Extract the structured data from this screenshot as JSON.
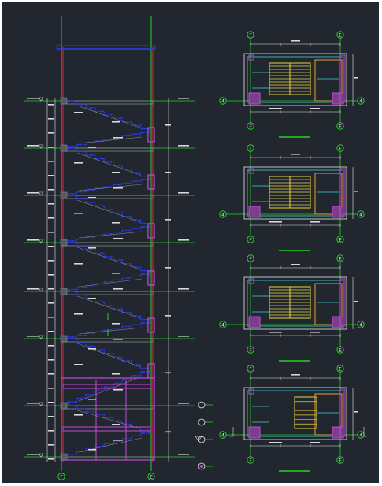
{
  "drawing": {
    "background": "#21262f",
    "colors": {
      "axis": "#22d422",
      "wall": "#e0263a",
      "stair": "#2a3ff0",
      "beam": "#c44ad8",
      "text": "#e8e8e8",
      "cyan": "#39d6d6",
      "yellow": "#e6d43a",
      "orange": "#e8a030",
      "gray": "#8a8a8a"
    },
    "section": {
      "axis_left": "F",
      "axis_right": "E",
      "floor_count": 9
    },
    "plans": [
      {
        "axis_top_left": "F",
        "axis_top_right": "E",
        "axis_side": "4"
      },
      {
        "axis_top_left": "F",
        "axis_top_right": "E",
        "axis_side": "4"
      },
      {
        "axis_top_left": "F",
        "axis_top_right": "E",
        "axis_side": "4"
      },
      {
        "axis_top_left": "F",
        "axis_top_right": "E",
        "axis_side": "4"
      }
    ]
  }
}
